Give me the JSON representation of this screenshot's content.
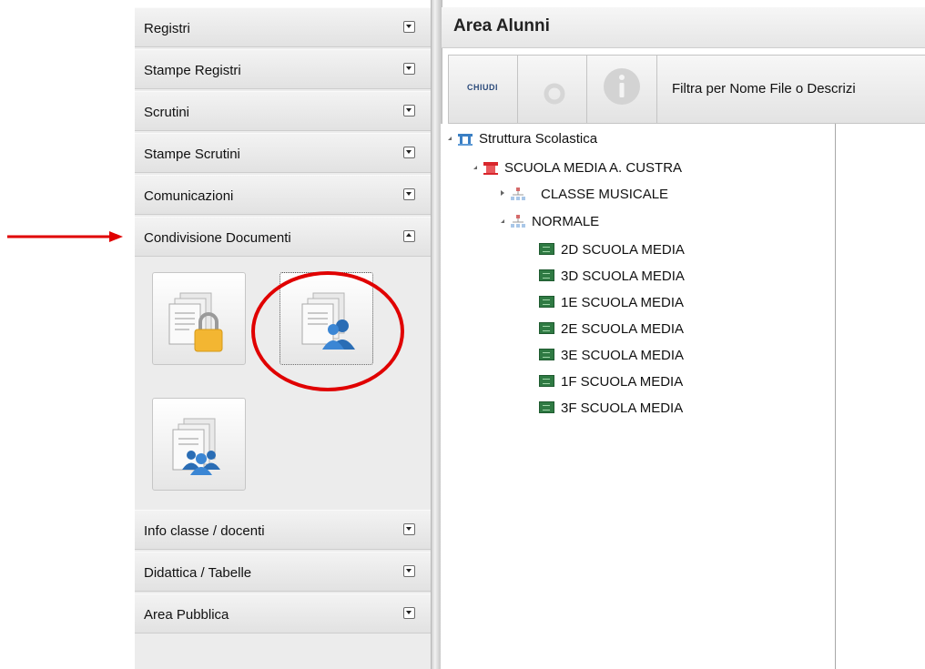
{
  "sidebar": {
    "sections": [
      {
        "label": "Registri",
        "expanded": false
      },
      {
        "label": "Stampe Registri",
        "expanded": false
      },
      {
        "label": "Scrutini",
        "expanded": false
      },
      {
        "label": "Stampe Scrutini",
        "expanded": false
      },
      {
        "label": "Comunicazioni",
        "expanded": false
      },
      {
        "label": "Condivisione Documenti",
        "expanded": true
      },
      {
        "label": "Info classe / docenti",
        "expanded": false
      },
      {
        "label": "Didattica / Tabelle",
        "expanded": false
      },
      {
        "label": "Area Pubblica",
        "expanded": false
      }
    ],
    "document_tiles": [
      {
        "icon": "documents-lock-icon",
        "selected": false
      },
      {
        "icon": "documents-user-icon",
        "selected": true
      },
      {
        "icon": "documents-group-icon",
        "selected": false
      }
    ]
  },
  "main": {
    "title": "Area Alunni",
    "toolbar": {
      "close_label": "CHIUDI",
      "refresh_icon": "refresh-icon",
      "info_icon": "info-icon",
      "filter_label": "Filtra per Nome File o Descrizi"
    },
    "tree": {
      "root": "Struttura Scolastica",
      "school": "SCUOLA MEDIA A. CUSTRA",
      "groups": [
        {
          "label": "CLASSE MUSICALE",
          "expanded": false
        },
        {
          "label": "NORMALE",
          "expanded": true
        }
      ],
      "classes": [
        "2D SCUOLA MEDIA",
        "3D SCUOLA MEDIA",
        "1E SCUOLA MEDIA",
        "2E SCUOLA MEDIA",
        "3E SCUOLA MEDIA",
        "1F SCUOLA MEDIA",
        "3F SCUOLA MEDIA"
      ]
    }
  },
  "annotations": {
    "arrow_color": "#e00000",
    "circle_color": "#e00000"
  },
  "colors": {
    "class_icon": "#2f7a43",
    "school_icon": "#d8262c",
    "root_icon": "#3a7fc4"
  }
}
